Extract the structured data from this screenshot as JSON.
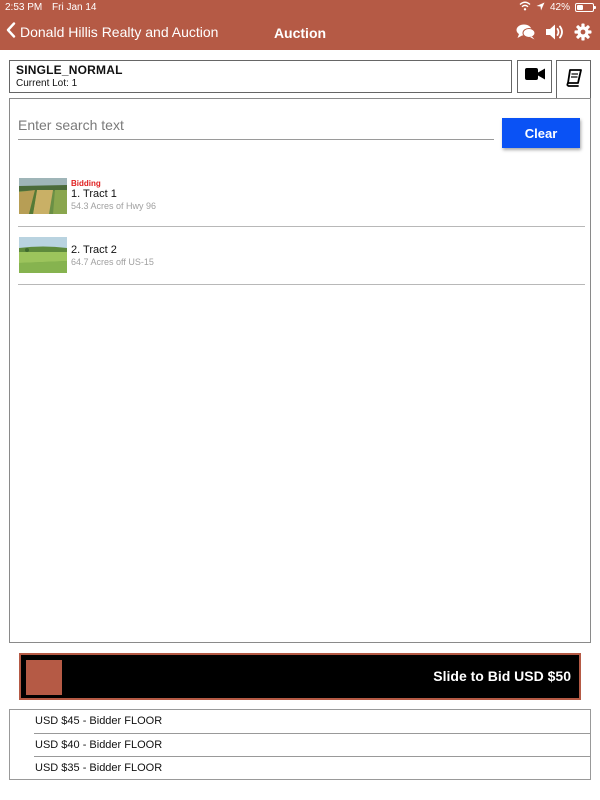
{
  "status_bar": {
    "time": "2:53 PM",
    "date": "Fri Jan 14",
    "battery": "42%"
  },
  "nav": {
    "back_label": "Donald Hillis Realty and Auction",
    "title": "Auction"
  },
  "auction": {
    "name": "SINGLE_NORMAL",
    "current_lot": "Current Lot: 1"
  },
  "search": {
    "placeholder": "Enter search text",
    "value": "",
    "clear_label": "Clear"
  },
  "lots": [
    {
      "status": "Bidding",
      "title": "1. Tract 1",
      "subtitle": "54.3 Acres of Hwy 96"
    },
    {
      "status": "",
      "title": "2. Tract 2",
      "subtitle": "64.7 Acres off US-15"
    }
  ],
  "slider": {
    "label": "Slide to Bid USD $50"
  },
  "bids": [
    {
      "text": "USD $45 - Bidder FLOOR"
    },
    {
      "text": "USD $40 - Bidder FLOOR"
    },
    {
      "text": "USD $35 - Bidder FLOOR"
    }
  ],
  "colors": {
    "brand": "#b55a45",
    "clear_button": "#0a52f5",
    "bidding_status": "#e02020",
    "slider_bg": "#000000"
  },
  "icons": [
    "chevron-left-icon",
    "chat-icon",
    "speaker-icon",
    "gear-icon",
    "video-camera-icon",
    "book-icon",
    "wifi-icon",
    "location-icon",
    "battery-icon"
  ]
}
